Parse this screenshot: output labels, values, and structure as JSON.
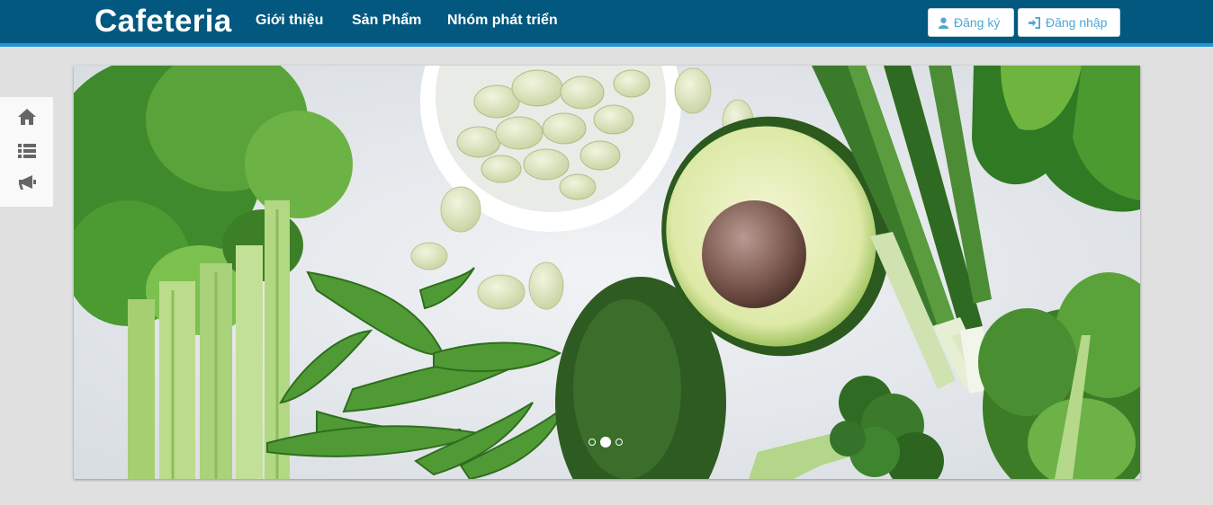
{
  "navbar": {
    "brand": "Cafeteria",
    "links": [
      "Giới thiệu",
      "Sản Phẩm",
      "Nhóm phát triển"
    ],
    "register_label": "Đăng ký",
    "login_label": "Đăng nhập",
    "register_icon": "user-icon",
    "login_icon": "sign-in-icon"
  },
  "sidebar": {
    "icons": [
      "home-icon",
      "list-icon",
      "bullhorn-icon"
    ]
  },
  "carousel": {
    "slide_count": 3,
    "active_index": 1,
    "image": "vegetables-slide"
  },
  "colors": {
    "navbar": "#03587f",
    "navbar_border": "#1f95d8",
    "page_background": "#e0e0e0",
    "button_text": "#4fa6d6"
  }
}
